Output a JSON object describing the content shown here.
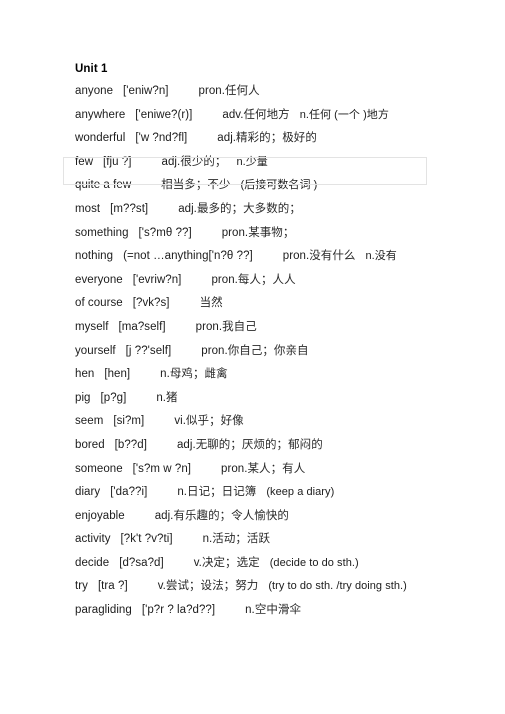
{
  "document": {
    "unit_title": "Unit 1",
    "entries": [
      {
        "word": "anyone",
        "phonetic": "['eniw?n]",
        "pos": "pron.",
        "chinese": "任何人",
        "note": ""
      },
      {
        "word": "anywhere",
        "phonetic": "['eniwe?(r)]",
        "pos": "adv.",
        "chinese": "任何地方",
        "note": "n.任何 (一个 )地方"
      },
      {
        "word": "wonderful",
        "phonetic": "['w ?nd?fl]",
        "pos": "adj.",
        "chinese": "精彩的；极好的",
        "note": ""
      },
      {
        "word": "few",
        "phonetic": "[fju ?]",
        "pos": "adj.",
        "chinese": "很少的；",
        "note": "n.少量"
      },
      {
        "word": "quite a few",
        "phonetic": "",
        "pos": "",
        "chinese": "相当多；不少",
        "note": "(后接可数名词 )"
      },
      {
        "word": "most",
        "phonetic": "[m??st]",
        "pos": "adj.",
        "chinese": "最多的；大多数的；",
        "note": ""
      },
      {
        "word": "something",
        "phonetic": "['s?mθ ??]",
        "pos": "pron.",
        "chinese": "某事物；",
        "note": ""
      },
      {
        "word": "nothing",
        "phonetic": "(=not …anything['n?θ ??]",
        "pos": "pron.",
        "chinese": "没有什么",
        "note": "n.没有"
      },
      {
        "word": "everyone",
        "phonetic": "['evriw?n]",
        "pos": "pron.",
        "chinese": "每人；人人",
        "note": ""
      },
      {
        "word": "of course",
        "phonetic": "[?vk?s]",
        "pos": "",
        "chinese": "当然",
        "note": ""
      },
      {
        "word": "myself",
        "phonetic": "[ma?self]",
        "pos": "pron.",
        "chinese": "我自己",
        "note": ""
      },
      {
        "word": "yourself",
        "phonetic": "[j ??'self]",
        "pos": "pron.",
        "chinese": "你自己；你亲自",
        "note": ""
      },
      {
        "word": "hen",
        "phonetic": "[hen]",
        "pos": "n.",
        "chinese": "母鸡；雌禽",
        "note": ""
      },
      {
        "word": "pig",
        "phonetic": "[p?g]",
        "pos": "n.",
        "chinese": "猪",
        "note": ""
      },
      {
        "word": "seem",
        "phonetic": "[si?m]",
        "pos": "vi.",
        "chinese": "似乎；好像",
        "note": ""
      },
      {
        "word": "bored",
        "phonetic": "[b??d]",
        "pos": "adj.",
        "chinese": "无聊的；厌烦的；郁闷的",
        "note": ""
      },
      {
        "word": "someone",
        "phonetic": "['s?m w ?n]",
        "pos": "pron.",
        "chinese": "某人；有人",
        "note": ""
      },
      {
        "word": "diary",
        "phonetic": "['da??i]",
        "pos": "n.",
        "chinese": "日记；日记簿",
        "note": "(keep a diary)"
      },
      {
        "word": "enjoyable",
        "phonetic": "",
        "pos": "adj.",
        "chinese": "有乐趣的；令人愉快的",
        "note": ""
      },
      {
        "word": "activity",
        "phonetic": "[?k't ?v?ti]",
        "pos": "n.",
        "chinese": "活动；活跃",
        "note": ""
      },
      {
        "word": "decide",
        "phonetic": "[d?sa?d]",
        "pos": "v.",
        "chinese": "决定；选定",
        "note": "(decide to do sth.)"
      },
      {
        "word": "try",
        "phonetic": "[tra ?]",
        "pos": "v.",
        "chinese": "尝试；设法；努力",
        "note": "(try to do sth. /try doing sth.)"
      },
      {
        "word": "paragliding",
        "phonetic": "['p?r ? la?d??]",
        "pos": "n.",
        "chinese": "空中滑伞",
        "note": ""
      }
    ]
  },
  "selection": {
    "highlighted_entry_word": "few",
    "border_color": "#e3e3e3"
  }
}
